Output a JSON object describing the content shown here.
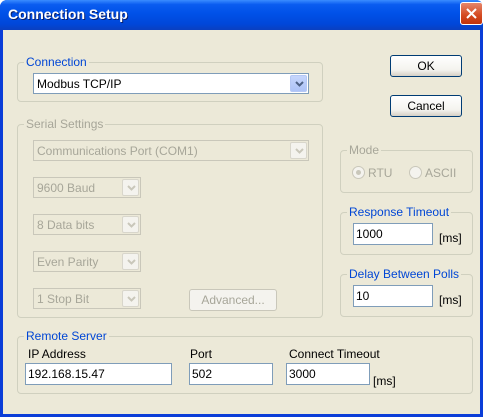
{
  "window": {
    "title": "Connection Setup"
  },
  "connection": {
    "group_label": "Connection",
    "value": "Modbus TCP/IP"
  },
  "buttons": {
    "ok": "OK",
    "cancel": "Cancel",
    "advanced": "Advanced..."
  },
  "serial": {
    "group_label": "Serial Settings",
    "port": "Communications Port (COM1)",
    "baud": "9600 Baud",
    "data_bits": "8 Data bits",
    "parity": "Even Parity",
    "stop_bits": "1 Stop Bit"
  },
  "mode": {
    "group_label": "Mode",
    "rtu": "RTU",
    "ascii": "ASCII",
    "selected": "RTU"
  },
  "response_timeout": {
    "group_label": "Response Timeout",
    "value": "1000",
    "unit": "[ms]"
  },
  "delay_polls": {
    "group_label": "Delay Between Polls",
    "value": "10",
    "unit": "[ms]"
  },
  "remote": {
    "group_label": "Remote Server",
    "ip_label": "IP Address",
    "ip_value": "192.168.15.47",
    "port_label": "Port",
    "port_value": "502",
    "timeout_label": "Connect Timeout",
    "timeout_value": "3000",
    "timeout_unit": "[ms]"
  },
  "colors": {
    "titlebar": "#0054e3",
    "dialog_bg": "#ece9d8",
    "group_label": "#0046d5",
    "close_button": "#d4491f"
  }
}
